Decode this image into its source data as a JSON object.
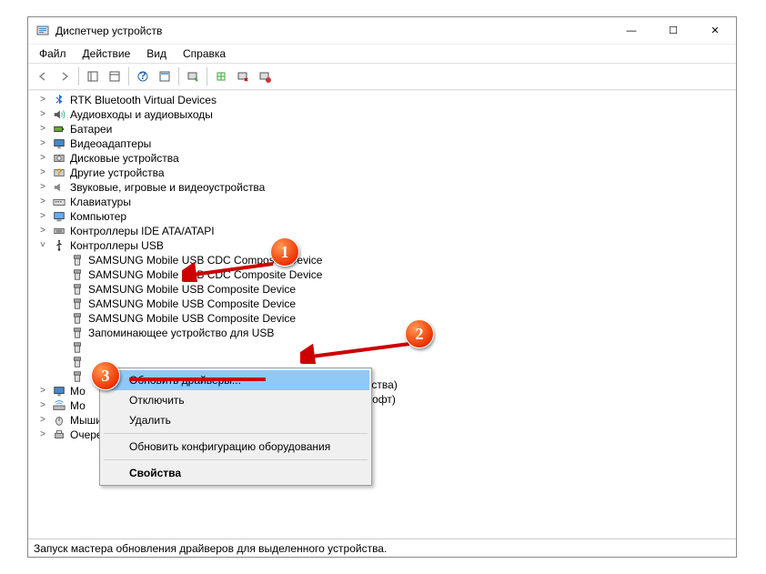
{
  "window": {
    "title": "Диспетчер устройств",
    "min_label": "—",
    "max_label": "☐",
    "close_label": "✕"
  },
  "menu": {
    "file": "Файл",
    "action": "Действие",
    "view": "Вид",
    "help": "Справка"
  },
  "tree": {
    "items": [
      {
        "label": "RTK Bluetooth Virtual Devices",
        "icon": "bluetooth"
      },
      {
        "label": "Аудиовходы и аудиовыходы",
        "icon": "audio"
      },
      {
        "label": "Батареи",
        "icon": "battery"
      },
      {
        "label": "Видеоадаптеры",
        "icon": "display"
      },
      {
        "label": "Дисковые устройства",
        "icon": "disk"
      },
      {
        "label": "Другие устройства",
        "icon": "unknown"
      },
      {
        "label": "Звуковые, игровые и видеоустройства",
        "icon": "sound"
      },
      {
        "label": "Клавиатуры",
        "icon": "keyboard"
      },
      {
        "label": "Компьютер",
        "icon": "computer"
      },
      {
        "label": "Контроллеры IDE ATA/ATAPI",
        "icon": "ide"
      },
      {
        "label": "Контроллеры USB",
        "icon": "usb",
        "expanded": true,
        "children": [
          {
            "label": "SAMSUNG Mobile USB CDC Composite Device",
            "icon": "usb-dev"
          },
          {
            "label": "SAMSUNG Mobile USB CDC Composite Device",
            "icon": "usb-dev"
          },
          {
            "label": "SAMSUNG Mobile USB Composite Device",
            "icon": "usb-dev"
          },
          {
            "label": "SAMSUNG Mobile USB Composite Device",
            "icon": "usb-dev"
          },
          {
            "label": "SAMSUNG Mobile USB Composite Device",
            "icon": "usb-dev"
          },
          {
            "label": "Запоминающее устройство для USB",
            "icon": "usb-dev"
          },
          {
            "label": "",
            "icon": "usb-dev"
          },
          {
            "label": "",
            "icon": "usb-dev"
          },
          {
            "label": "",
            "icon": "usb-dev"
          }
        ]
      },
      {
        "label": "Мо",
        "icon": "display"
      },
      {
        "label": "Мо",
        "icon": "modem"
      },
      {
        "label": "Мыши и иные указывающие устройства",
        "icon": "mouse"
      },
      {
        "label": "Очереди печати",
        "icon": "printer"
      }
    ],
    "hidden_right_1": "устройства)",
    "hidden_right_2": "айкрософт)"
  },
  "context": {
    "update": "Обновить драйверы...",
    "disable": "Отключить",
    "delete": "Удалить",
    "refresh": "Обновить конфигурацию оборудования",
    "props": "Свойства"
  },
  "status": {
    "text": "Запуск мастера обновления драйверов для выделенного устройства."
  },
  "markers": {
    "m1": "1",
    "m2": "2",
    "m3": "3"
  }
}
